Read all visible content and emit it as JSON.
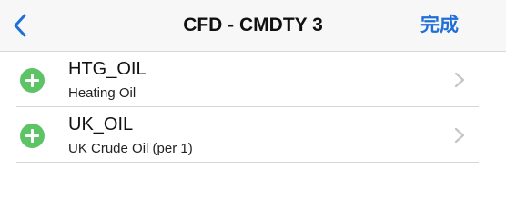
{
  "navbar": {
    "title": "CFD - CMDTY 3",
    "done_label": "完成",
    "back_icon": "chevron-left-icon",
    "accent_color": "#1f6fd6"
  },
  "items": [
    {
      "code": "HTG_OIL",
      "name": "Heating Oil",
      "icon": "add-circle-icon"
    },
    {
      "code": "UK_OIL",
      "name": "UK Crude Oil (per 1)",
      "icon": "add-circle-icon"
    }
  ],
  "colors": {
    "add_icon": "#5cc466",
    "chevron": "#c4c4c4"
  }
}
